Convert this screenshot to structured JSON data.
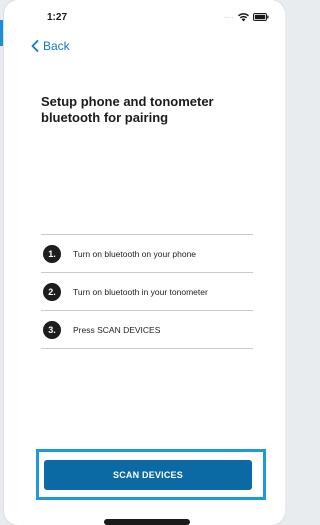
{
  "status_bar": {
    "time": "1:27",
    "signal": "....",
    "wifi_icon": "wifi-icon",
    "battery_icon": "battery-icon"
  },
  "nav": {
    "back_label": "Back",
    "back_icon": "chevron-left-icon"
  },
  "page": {
    "title": "Setup phone and tonometer bluetooth for pairing"
  },
  "steps": [
    {
      "number": "1.",
      "text": "Turn on bluetooth on your phone"
    },
    {
      "number": "2.",
      "text": "Turn on bluetooth in your tonometer"
    },
    {
      "number": "3.",
      "text": "Press SCAN DEVICES"
    }
  ],
  "actions": {
    "scan_label": "SCAN DEVICES"
  },
  "colors": {
    "accent": "#1478c8",
    "button": "#0b6aa4",
    "highlight": "#1e9ad6"
  }
}
